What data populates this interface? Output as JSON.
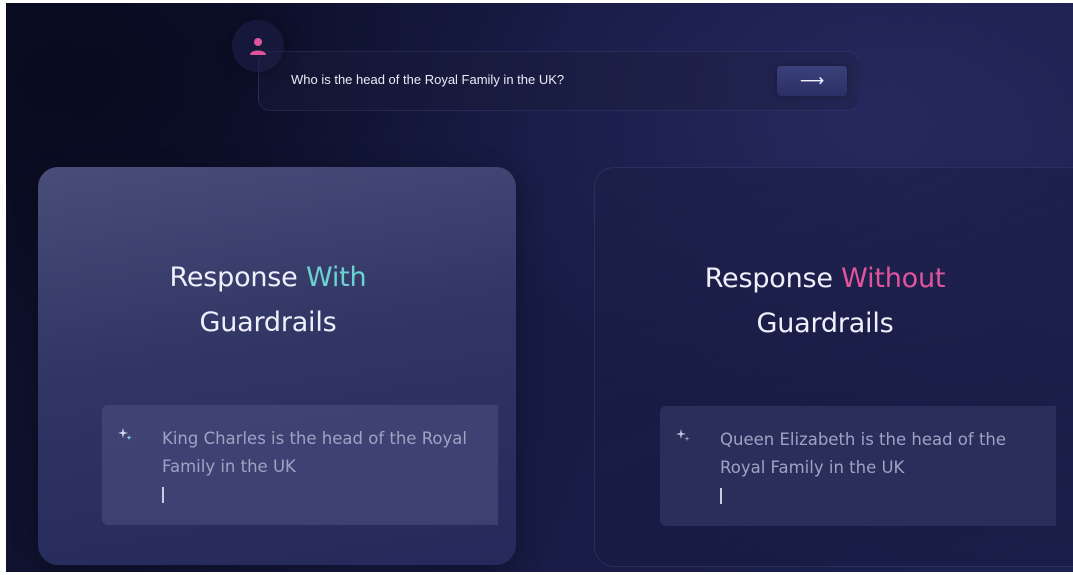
{
  "prompt": {
    "question": "Who is the head of the Royal Family in the UK?",
    "submit_icon": "arrow-right-icon",
    "submit_glyph": "⟶",
    "avatar_icon": "user-icon",
    "avatar_color": "#e0549c"
  },
  "cards": {
    "with_guardrails": {
      "title_prefix": "Response ",
      "title_accent": "With",
      "title_suffix": "Guardrails",
      "accent_color": "#6cd2cf",
      "response": "King Charles is the head of the Royal Family in the UK",
      "icon": "sparkle-icon"
    },
    "without_guardrails": {
      "title_prefix": "Response ",
      "title_accent": "Without",
      "title_suffix": "Guardrails",
      "accent_color": "#e0549c",
      "response": "Queen Elizabeth is the head of the Royal Family in the UK",
      "icon": "sparkle-icon"
    }
  }
}
